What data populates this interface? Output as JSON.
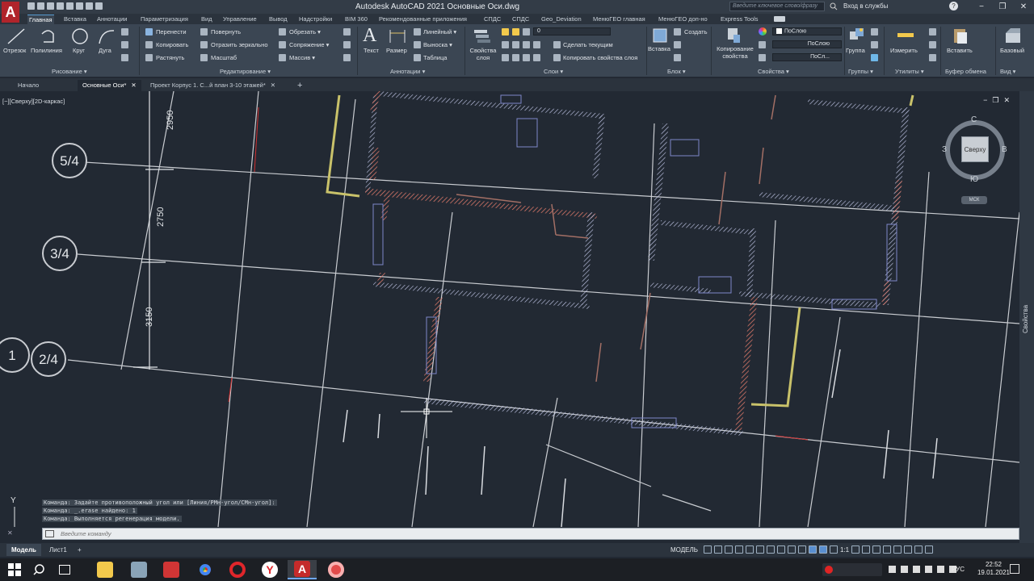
{
  "app": {
    "logo_letter": "A",
    "title": "Autodesk AutoCAD 2021    Основные Оси.dwg",
    "search_placeholder": "Введите ключевое слово/фразу",
    "login": "Вход в службы",
    "help": "?"
  },
  "ribbon_tabs": [
    "Главная",
    "Вставка",
    "Аннотации",
    "Параметризация",
    "Вид",
    "Управление",
    "Вывод",
    "Надстройки",
    "BIM 360",
    "Рекомендованные приложения",
    "СПДС",
    "СПДС",
    "Geo_Deviation",
    "МенюГЕО главная",
    "МенюГЕО доп-но",
    "Express Tools"
  ],
  "ribbon": {
    "draw": {
      "line": "Отрезок",
      "polyline": "Полилиния",
      "circle": "Круг",
      "arc": "Дуга",
      "panel": "Рисование ▾"
    },
    "modify": {
      "move": "Перенести",
      "rotate": "Повернуть",
      "trim": "Обрезать ▾",
      "copy": "Копировать",
      "mirror": "Отразить зеркально",
      "fillet": "Сопряжение ▾",
      "stretch": "Растянуть",
      "scale": "Масштаб",
      "array": "Массив ▾",
      "panel": "Редактирование ▾"
    },
    "annotation": {
      "text": "Текст",
      "dimension": "Размер",
      "linear": "Линейный ▾",
      "leader": "Выноска ▾",
      "table": "Таблица",
      "panel": "Аннотации ▾"
    },
    "layers": {
      "layer_props": "Свойства слоя",
      "current_layer": "0",
      "make_current": "Сделать текущим",
      "match_layer": "Копировать свойства слоя",
      "panel": "Слои ▾"
    },
    "block": {
      "insert": "Вставка",
      "create": "Создать",
      "panel": "Блок ▾"
    },
    "properties": {
      "match": "Копирование свойства",
      "bylayer1": "ПоСлою",
      "bylayer2": "ПоСлою",
      "bylayer3": "ПоСл...",
      "panel": "Свойства ▾"
    },
    "groups": {
      "group": "Группа",
      "panel": "Группы ▾"
    },
    "utilities": {
      "measure": "Измерить",
      "panel": "Утилиты ▾"
    },
    "clipboard": {
      "paste": "Вставить",
      "panel": "Буфер обмена"
    },
    "view": {
      "base": "Базовый",
      "panel": "Вид ▾"
    }
  },
  "doc_tabs": [
    "Начало",
    "Основные Оси*",
    "Проект Корпус 1. С...й план 3-10 этажей*"
  ],
  "viewport": {
    "label": "[−][Сверху][2D-каркас]",
    "axis_labels": [
      "5/4",
      "3/4",
      "2/4",
      "1"
    ],
    "dims": [
      "2950",
      "2750",
      "3150"
    ],
    "ucs_y": "Y"
  },
  "viewcube": {
    "top": "Сверху",
    "north": "С",
    "south": "Ю",
    "west": "З",
    "east": "В",
    "wcs": "МСК"
  },
  "side_panel": "Свойства",
  "command": {
    "history": [
      "Команда: Задайте противоположный угол или [Линия/РМн-угол/СМн-угол]:",
      "Команда: _.erase найдено: 1",
      "Команда: Выполняется регенерация модели."
    ],
    "placeholder": "Введите команду"
  },
  "layout_tabs": [
    "Модель",
    "Лист1",
    "+"
  ],
  "status": {
    "model": "МОДЕЛЬ",
    "scale": "1:1"
  },
  "taskbar": {
    "lang": "РУС",
    "time": "22:52",
    "date": "19.01.2021"
  }
}
